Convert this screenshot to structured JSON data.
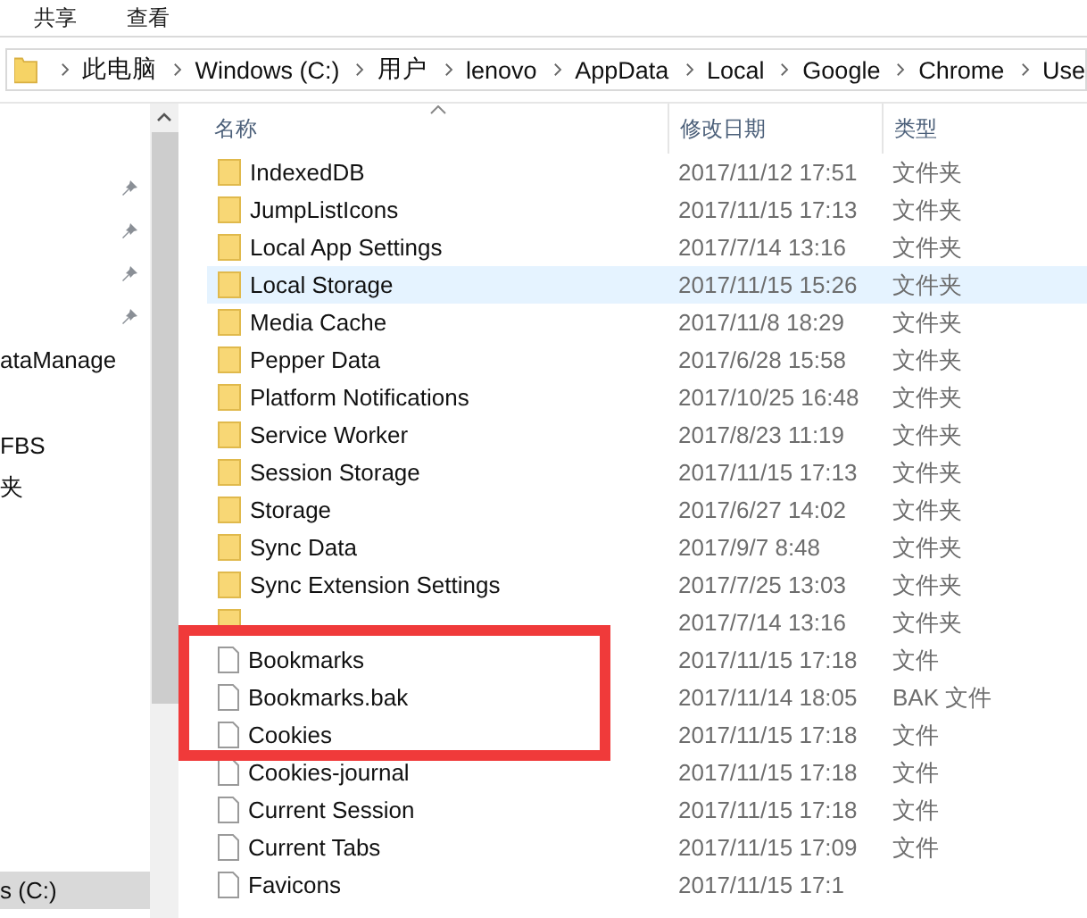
{
  "ribbon_tabs": [
    {
      "label": "共享"
    },
    {
      "label": "查看"
    }
  ],
  "address_bar": {
    "crumbs": [
      "此电脑",
      "Windows (C:)",
      "用户",
      "lenovo",
      "AppData",
      "Local",
      "Google",
      "Chrome",
      "Use"
    ]
  },
  "nav_pane": {
    "items": [
      {
        "pinned": true
      },
      {
        "pinned": true
      },
      {
        "pinned": true
      },
      {
        "pinned": true
      },
      {
        "label": "ataManage",
        "pinned": false
      },
      {
        "pinned": false
      },
      {
        "label": "FBS",
        "pinned": false
      },
      {
        "label": "夹",
        "pinned": false
      }
    ],
    "bottom_item": {
      "label": "s (C:)",
      "selected": true
    }
  },
  "table": {
    "columns": [
      "名称",
      "修改日期",
      "类型"
    ],
    "rows": [
      {
        "kind": "folder",
        "name": "IndexedDB",
        "date": "2017/11/12 17:51",
        "type": "文件夹",
        "selected": false
      },
      {
        "kind": "folder",
        "name": "JumpListIcons",
        "date": "2017/11/15 17:13",
        "type": "文件夹",
        "selected": false
      },
      {
        "kind": "folder",
        "name": "Local App Settings",
        "date": "2017/7/14 13:16",
        "type": "文件夹",
        "selected": false
      },
      {
        "kind": "folder",
        "name": "Local Storage",
        "date": "2017/11/15 15:26",
        "type": "文件夹",
        "selected": true
      },
      {
        "kind": "folder",
        "name": "Media Cache",
        "date": "2017/11/8 18:29",
        "type": "文件夹",
        "selected": false
      },
      {
        "kind": "folder",
        "name": "Pepper Data",
        "date": "2017/6/28 15:58",
        "type": "文件夹",
        "selected": false
      },
      {
        "kind": "folder",
        "name": "Platform Notifications",
        "date": "2017/10/25 16:48",
        "type": "文件夹",
        "selected": false
      },
      {
        "kind": "folder",
        "name": "Service Worker",
        "date": "2017/8/23 11:19",
        "type": "文件夹",
        "selected": false
      },
      {
        "kind": "folder",
        "name": "Session Storage",
        "date": "2017/11/15 17:13",
        "type": "文件夹",
        "selected": false
      },
      {
        "kind": "folder",
        "name": "Storage",
        "date": "2017/6/27 14:02",
        "type": "文件夹",
        "selected": false
      },
      {
        "kind": "folder",
        "name": "Sync Data",
        "date": "2017/9/7 8:48",
        "type": "文件夹",
        "selected": false
      },
      {
        "kind": "folder",
        "name": "Sync Extension Settings",
        "date": "2017/7/25 13:03",
        "type": "文件夹",
        "selected": false
      },
      {
        "kind": "folder",
        "date": "2017/7/14 13:16",
        "type": "文件夹",
        "selected": false
      },
      {
        "kind": "file",
        "name": "Bookmarks",
        "date": "2017/11/15 17:18",
        "type": "文件",
        "selected": false
      },
      {
        "kind": "file",
        "name": "Bookmarks.bak",
        "date": "2017/11/14 18:05",
        "type": "BAK 文件",
        "selected": false
      },
      {
        "kind": "file",
        "name": "Cookies",
        "date": "2017/11/15 17:18",
        "type": "文件",
        "selected": false
      },
      {
        "kind": "file",
        "name": "Cookies-journal",
        "date": "2017/11/15 17:18",
        "type": "文件",
        "selected": false
      },
      {
        "kind": "file",
        "name": "Current Session",
        "date": "2017/11/15 17:18",
        "type": "文件",
        "selected": false
      },
      {
        "kind": "file",
        "name": "Current Tabs",
        "date": "2017/11/15 17:09",
        "type": "文件",
        "selected": false
      },
      {
        "kind": "file",
        "name": "Favicons",
        "date": "2017/11/15 17:1",
        "selected": false
      }
    ]
  }
}
